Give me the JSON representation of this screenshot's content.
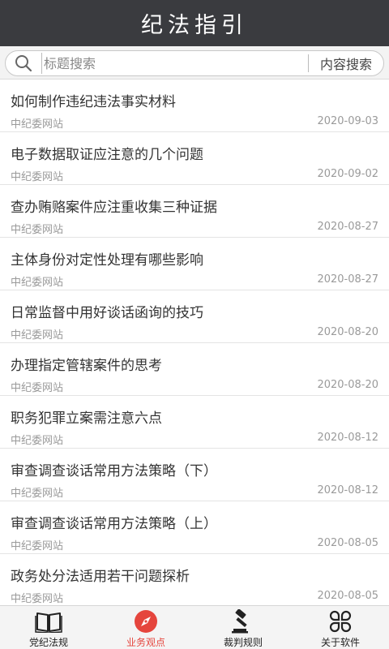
{
  "header": {
    "title": "纪法指引"
  },
  "search": {
    "placeholder": "标题搜索",
    "content_search_label": "内容搜索"
  },
  "articles": [
    {
      "title": "如何制作违纪违法事实材料",
      "source": "中纪委网站",
      "date": "2020-09-03"
    },
    {
      "title": "电子数据取证应注意的几个问题",
      "source": "中纪委网站",
      "date": "2020-09-02"
    },
    {
      "title": "查办贿赂案件应注重收集三种证据",
      "source": "中纪委网站",
      "date": "2020-08-27"
    },
    {
      "title": "主体身份对定性处理有哪些影响",
      "source": "中纪委网站",
      "date": "2020-08-27"
    },
    {
      "title": "日常监督中用好谈话函询的技巧",
      "source": "中纪委网站",
      "date": "2020-08-20"
    },
    {
      "title": "办理指定管辖案件的思考",
      "source": "中纪委网站",
      "date": "2020-08-20"
    },
    {
      "title": "职务犯罪立案需注意六点",
      "source": "中纪委网站",
      "date": "2020-08-12"
    },
    {
      "title": "审查调查谈话常用方法策略（下）",
      "source": "中纪委网站",
      "date": "2020-08-12"
    },
    {
      "title": "审查调查谈话常用方法策略（上）",
      "source": "中纪委网站",
      "date": "2020-08-05"
    },
    {
      "title": "政务处分法适用若干问题探析",
      "source": "中纪委网站",
      "date": "2020-08-05"
    }
  ],
  "tabbar": {
    "accent_color": "#e5453d",
    "active_tab": "business-views",
    "tabs": [
      {
        "label": "党纪法规",
        "icon": "open-book-icon"
      },
      {
        "label": "业务观点",
        "icon": "compass-icon"
      },
      {
        "label": "裁判规则",
        "icon": "gavel-icon"
      },
      {
        "label": "关于软件",
        "icon": "cloverleaf-icon"
      }
    ]
  }
}
